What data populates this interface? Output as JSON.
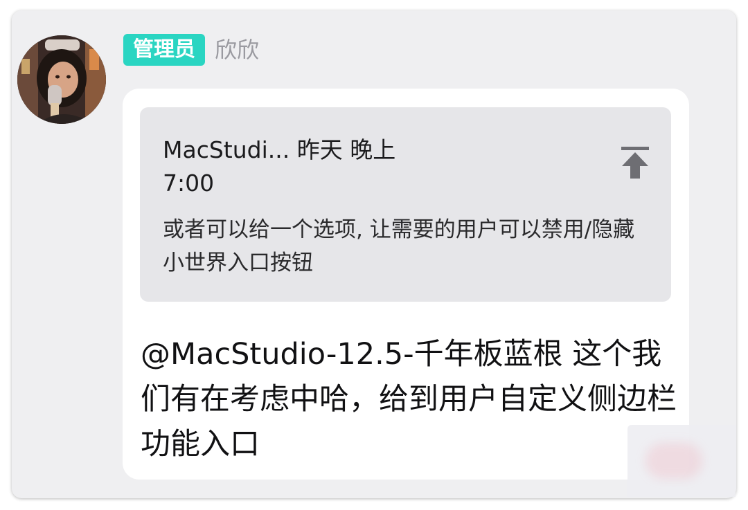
{
  "message": {
    "sender": {
      "role_badge": "管理员",
      "name": "欣欣"
    },
    "quote": {
      "author": "MacStudi...",
      "time": "昨天 晚上",
      "time_detail": "7:00",
      "text": "或者可以给一个选项, 让需要的用户可以禁用/隐藏小世界入口按钮",
      "jump_icon": "arrow-up-to-top-icon"
    },
    "reply_text": "@MacStudio-12.5-千年板蓝根 这个我们有在考虑中哈，给到用户自定义侧边栏功能入口"
  },
  "colors": {
    "badge_bg": "#2ad5c2",
    "page_bg": "#efeff1",
    "bubble_bg": "#ffffff",
    "quote_bg": "#e6e6e9",
    "name_text": "#9a9aa0"
  }
}
